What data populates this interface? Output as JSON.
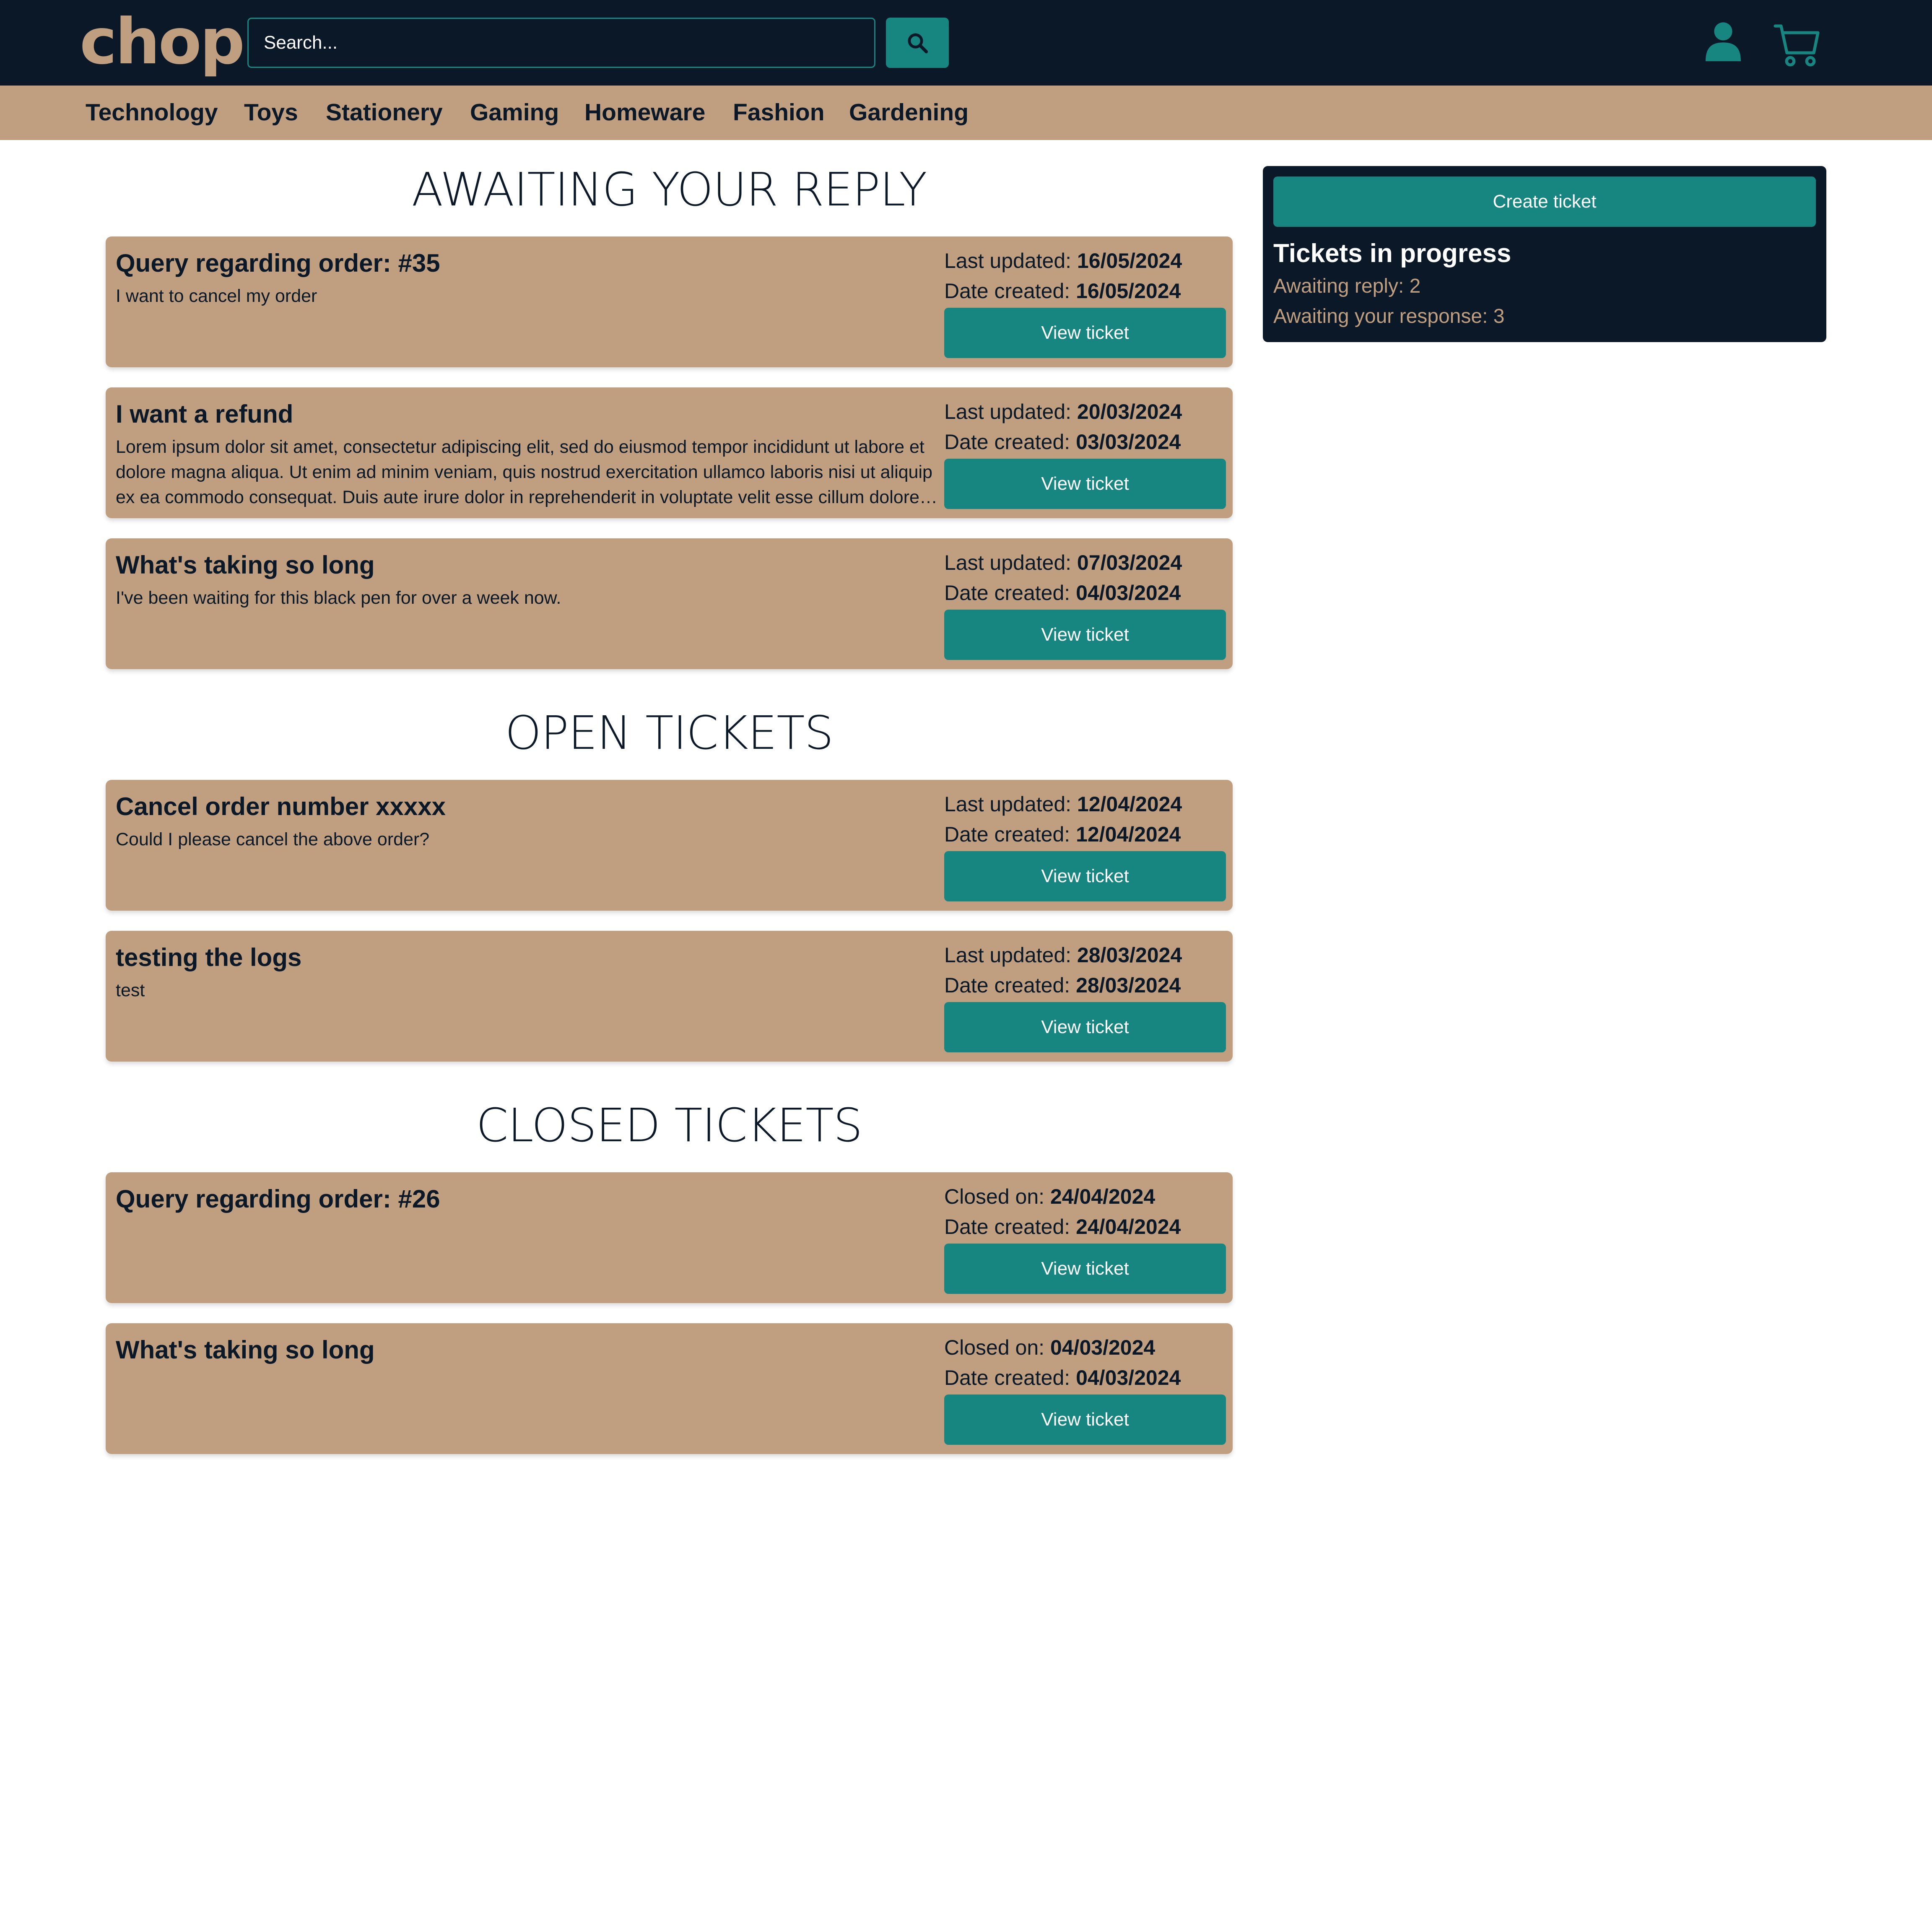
{
  "header": {
    "logo": "chop",
    "search_placeholder": "Search...",
    "search_icon": "magnifier-icon",
    "account_icon": "user-icon",
    "cart_icon": "shopping-cart-icon"
  },
  "categories": [
    "Technology",
    "Toys",
    "Stationery",
    "Gaming",
    "Homeware",
    "Fashion",
    "Gardening"
  ],
  "sections": {
    "awaiting": {
      "title": "AWAITING YOUR REPLY",
      "tickets": [
        {
          "title": "Query regarding order: #35",
          "description": "I want to cancel my order",
          "meta1_label": "Last updated: ",
          "meta1_value": "16/05/2024",
          "meta2_label": "Date created: ",
          "meta2_value": "16/05/2024",
          "button": "View ticket"
        },
        {
          "title": "I want a refund",
          "description": "Lorem ipsum dolor sit amet, consectetur adipiscing elit, sed do eiusmod tempor incididunt ut labore et dolore magna aliqua. Ut enim ad minim veniam, quis nostrud exercitation ullamco laboris nisi ut aliquip ex ea commodo consequat. Duis aute irure dolor in reprehenderit in voluptate velit esse cillum dolore eu fugiat nulla pariatur.",
          "meta1_label": "Last updated: ",
          "meta1_value": "20/03/2024",
          "meta2_label": "Date created: ",
          "meta2_value": "03/03/2024",
          "button": "View ticket"
        },
        {
          "title": "What's taking so long",
          "description": "I've been waiting for this black pen for over a week now.",
          "meta1_label": "Last updated: ",
          "meta1_value": "07/03/2024",
          "meta2_label": "Date created: ",
          "meta2_value": "04/03/2024",
          "button": "View ticket"
        }
      ]
    },
    "open": {
      "title": "OPEN TICKETS",
      "tickets": [
        {
          "title": "Cancel order number xxxxx",
          "description": "Could I please cancel the above order?",
          "meta1_label": "Last updated: ",
          "meta1_value": "12/04/2024",
          "meta2_label": "Date created: ",
          "meta2_value": "12/04/2024",
          "button": "View ticket"
        },
        {
          "title": "testing the logs",
          "description": "test",
          "meta1_label": "Last updated: ",
          "meta1_value": "28/03/2024",
          "meta2_label": "Date created: ",
          "meta2_value": "28/03/2024",
          "button": "View ticket"
        }
      ]
    },
    "closed": {
      "title": "CLOSED TICKETS",
      "tickets": [
        {
          "title": "Query regarding order: #26",
          "description": "",
          "meta1_label": "Closed on: ",
          "meta1_value": "24/04/2024",
          "meta2_label": "Date created: ",
          "meta2_value": "24/04/2024",
          "button": "View ticket"
        },
        {
          "title": "What's taking so long",
          "description": "",
          "meta1_label": "Closed on: ",
          "meta1_value": "04/03/2024",
          "meta2_label": "Date created: ",
          "meta2_value": "04/03/2024",
          "button": "View ticket"
        }
      ]
    }
  },
  "sidebar": {
    "create_button": "Create ticket",
    "title": "Tickets in progress",
    "awaiting_reply": "Awaiting reply: 2",
    "awaiting_response": "Awaiting your response: 3"
  },
  "colors": {
    "navy": "#0b1828",
    "tan": "#bf9f7f",
    "teal": "#178580",
    "background": "#ffffff"
  }
}
